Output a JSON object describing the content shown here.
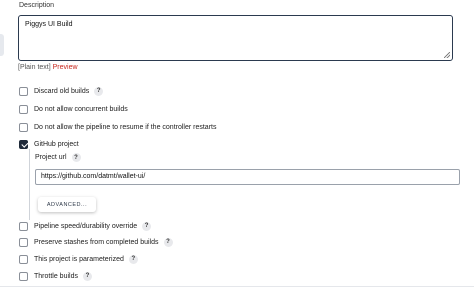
{
  "description": {
    "label": "Description",
    "value": "Piggys UI Build",
    "format_label": "[Plain text]",
    "preview_label": "Preview"
  },
  "options": [
    {
      "label": "Discard old builds",
      "checked": false,
      "help": "?"
    },
    {
      "label": "Do not allow concurrent builds",
      "checked": false,
      "help": ""
    },
    {
      "label": "Do not allow the pipeline to resume if the controller restarts",
      "checked": false,
      "help": ""
    },
    {
      "label": "GitHub project",
      "checked": true,
      "help": ""
    }
  ],
  "github": {
    "project_url_label": "Project url",
    "help": "?",
    "project_url_value": "https://github.com/datmt/wallet-ui/",
    "advanced_label": "ADVANCED..."
  },
  "more_options": [
    {
      "label": "Pipeline speed/durability override",
      "checked": false,
      "help": "?"
    },
    {
      "label": "Preserve stashes from completed builds",
      "checked": false,
      "help": "?"
    },
    {
      "label": "This project is parameterized",
      "checked": false,
      "help": "?"
    },
    {
      "label": "Throttle builds",
      "checked": false,
      "help": "?"
    }
  ],
  "colors": {
    "preview_link": "#c7271e",
    "checked_box": "#1f2a3a",
    "textarea_border": "#2b3a4f"
  }
}
